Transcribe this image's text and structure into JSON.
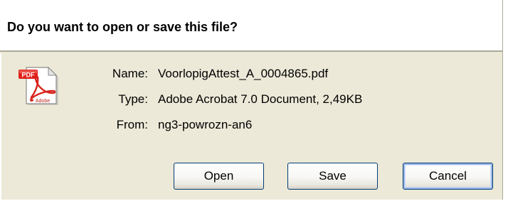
{
  "dialog": {
    "title": "Do you want to open or save this file?"
  },
  "file": {
    "icon": "pdf-file-icon",
    "icon_badge": "PDF",
    "icon_brand": "Adobe",
    "name_label": "Name:",
    "name_value": "VoorlopigAttest_A_0004865.pdf",
    "type_label": "Type:",
    "type_value": "Adobe Acrobat 7.0 Document, 2,49KB",
    "from_label": "From:",
    "from_value": "ng3-powrozn-an6"
  },
  "buttons": {
    "open_label": "Open",
    "save_label": "Save",
    "cancel_label": "Cancel"
  },
  "colors": {
    "dialog_background": "#ece9d8",
    "header_background": "#ffffff",
    "button_border": "#003c74",
    "pdf_badge_red": "#e0211b"
  }
}
